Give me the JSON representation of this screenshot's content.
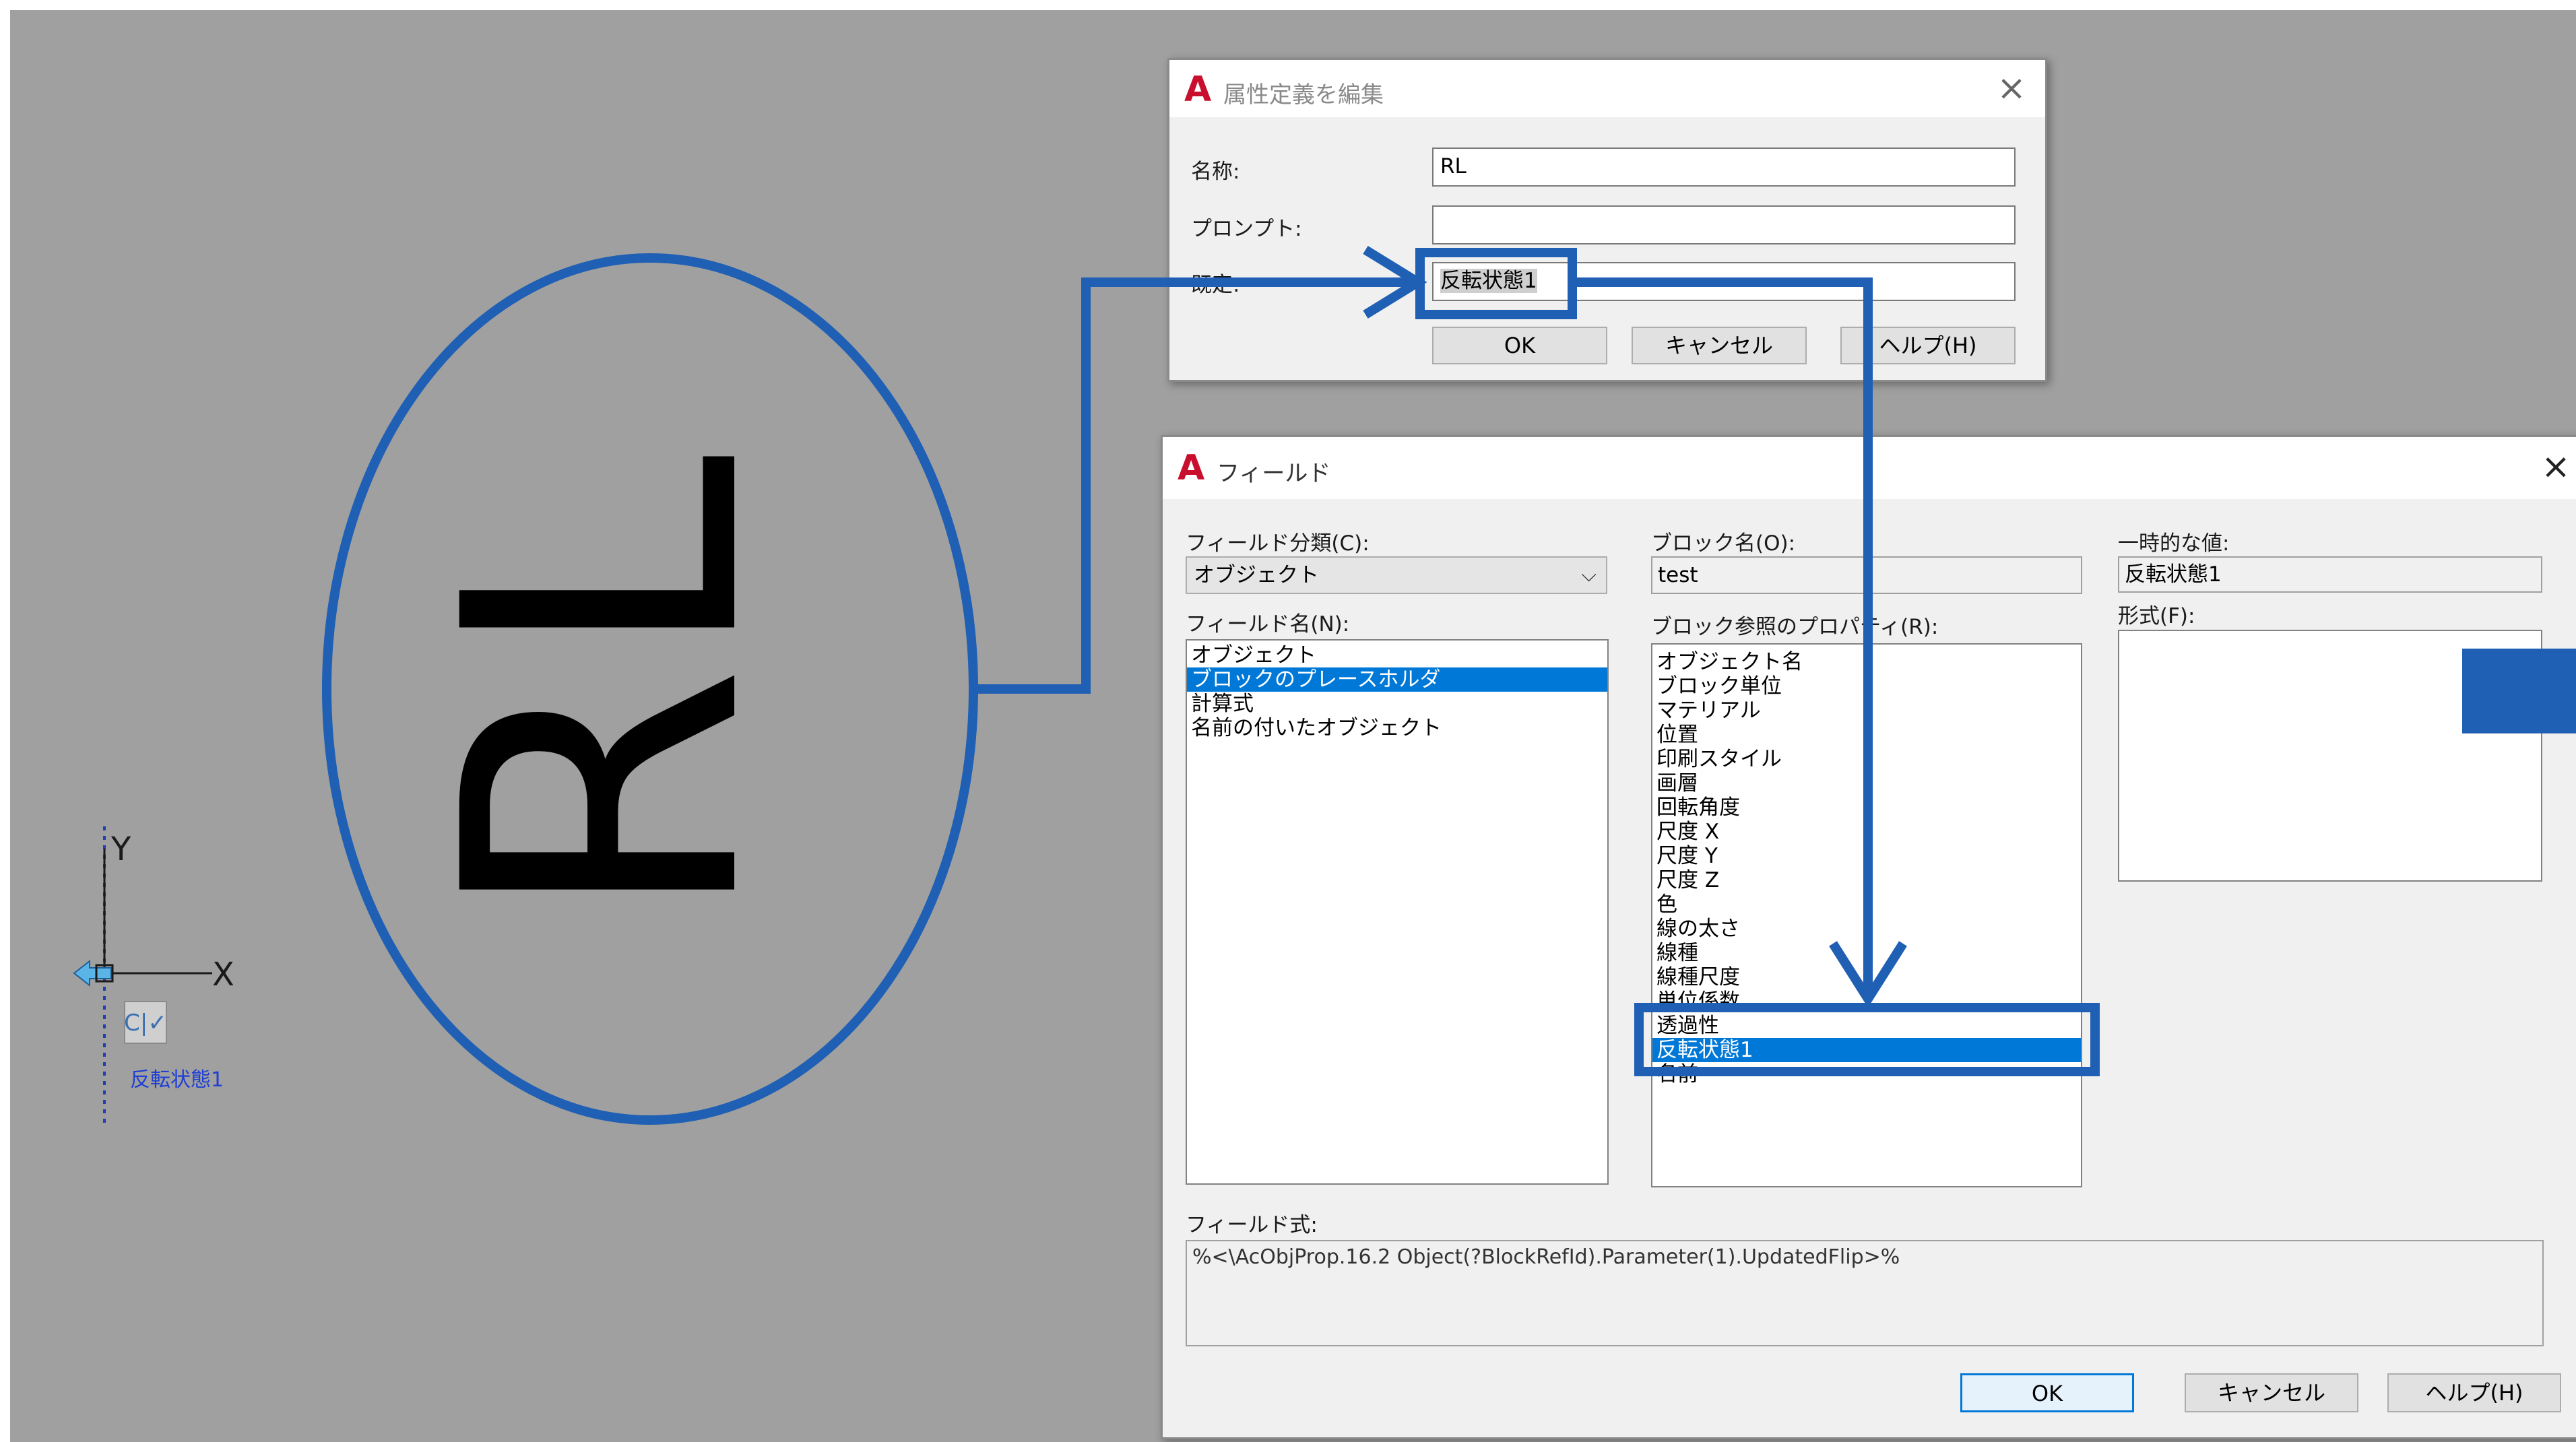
{
  "drawing": {
    "big_text": "RL",
    "ucs_y": "Y",
    "ucs_x": "X",
    "attr_label": "反転状態1",
    "block_icon": "block-attribute-icon"
  },
  "edit_dialog": {
    "title": "属性定義を編集",
    "labels": {
      "name": "名称:",
      "prompt": "プロンプト:",
      "default": "既定:"
    },
    "values": {
      "name": "RL",
      "prompt": "",
      "default": "反転状態1"
    },
    "buttons": {
      "ok": "OK",
      "cancel": "キャンセル",
      "help": "ヘルプ(H)"
    }
  },
  "field_dialog": {
    "title": "フィールド",
    "category_label": "フィールド分類(C):",
    "category_value": "オブジェクト",
    "names_label": "フィールド名(N):",
    "names": [
      "オブジェクト",
      "ブロックのプレースホルダ",
      "計算式",
      "名前の付いたオブジェクト"
    ],
    "names_selected": 1,
    "block_name_label": "ブロック名(O):",
    "block_name_value": "test",
    "props_label": "ブロック参照のプロパティ(R):",
    "props": [
      "オブジェクト名",
      "ブロック単位",
      "マテリアル",
      "位置",
      "印刷スタイル",
      "画層",
      "回転角度",
      "尺度 X",
      "尺度 Y",
      "尺度 Z",
      "色",
      "線の太さ",
      "線種",
      "線種尺度",
      "単位係数",
      "透過性",
      "反転状態1",
      "名前"
    ],
    "props_selected": 16,
    "temp_value_label": "一時的な値:",
    "temp_value": "反転状態1",
    "format_label": "形式(F):",
    "expression_label": "フィールド式:",
    "expression": "%<\\AcObjProp.16.2 Object(?BlockRefId).Parameter(1).UpdatedFlip>%",
    "buttons": {
      "ok": "OK",
      "cancel": "キャンセル",
      "help": "ヘルプ(H)"
    }
  },
  "colors": {
    "annotation": "#1f5fb4",
    "canvas": "#a0a0a0",
    "selection": "#0078d7",
    "logo": "#c8102e"
  }
}
